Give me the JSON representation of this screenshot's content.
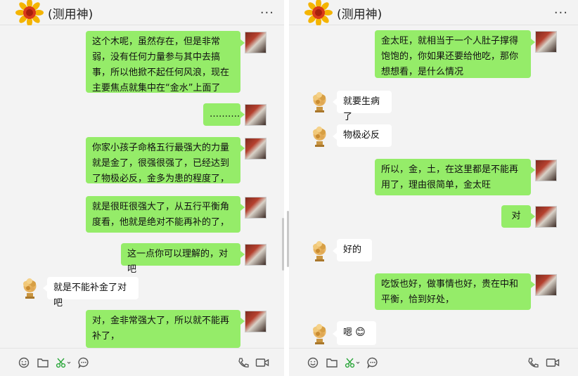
{
  "left_window": {
    "title": "(测用神)",
    "more_label": "···",
    "messages": [
      {
        "from": "me",
        "text": "这个木呢，虽然存在，但是非常弱，没有任何力量参与其中去搞事，所以他掀不起任何风浪，现在主要焦点就集中在“金水”上面了"
      },
      {
        "from": "me",
        "text": "………."
      },
      {
        "from": "me",
        "text": "你家小孩子命格五行最强大的力量就是金了，很强很强了，已经达到了物极必反，金多为患的程度了，"
      },
      {
        "from": "me",
        "text": "就是很旺很强大了，从五行平衡角度看，他就是绝对不能再补的了，"
      },
      {
        "from": "me",
        "text": "这一点你可以理解的，对吧"
      },
      {
        "from": "them",
        "text": "就是不能补金了对吧"
      },
      {
        "from": "me",
        "text": "对，金非常强大了，所以就不能再补了，"
      }
    ]
  },
  "right_window": {
    "title": "(测用神)",
    "more_label": "···",
    "messages": [
      {
        "from": "me",
        "text": "金太旺，就相当于一个人肚子撑得饱饱的，你如果还要给他吃，那你想想看，是什么情况"
      },
      {
        "from": "them",
        "text": "就要生病了"
      },
      {
        "from": "them",
        "text": "物极必反"
      },
      {
        "from": "me",
        "text": "所以，金，土，在这里都是不能再用了，理由很简单，金太旺"
      },
      {
        "from": "me",
        "text": "对"
      },
      {
        "from": "them",
        "text": "好的"
      },
      {
        "from": "me",
        "text": "吃饭也好，做事情也好，贵在中和平衡，恰到好处，"
      },
      {
        "from": "them",
        "text": "嗯",
        "emoji": "😊"
      }
    ]
  },
  "toolbar_icons": [
    "emoji-icon",
    "folder-icon",
    "scissors-icon",
    "chat-history-icon",
    "voice-call-icon",
    "video-call-icon"
  ],
  "colors": {
    "my_bubble": "#95ec69",
    "their_bubble": "#ffffff",
    "background": "#f3f3f3"
  }
}
